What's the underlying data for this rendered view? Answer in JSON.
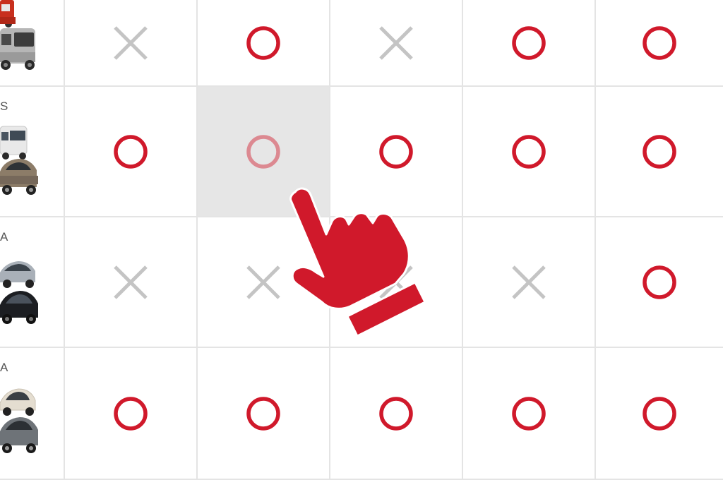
{
  "colors": {
    "circle": "#d0192b",
    "cross": "#c4c4c4",
    "grid_line": "#e4e4e4",
    "highlight": "#e6e6e6",
    "pointer": "#d0192b"
  },
  "rows": [
    {
      "label": "",
      "car_icons": [
        "red-boxy-van-icon",
        "silver-minivan-icon"
      ],
      "marks": [
        "cross",
        "circle",
        "cross",
        "circle",
        "circle"
      ]
    },
    {
      "label": "S",
      "car_icons": [
        "white-minivan-icon",
        "bronze-hatchback-icon"
      ],
      "marks": [
        "circle",
        "circle",
        "circle",
        "circle",
        "circle"
      ]
    },
    {
      "label": "A",
      "car_icons": [
        "silver-sedan-icon",
        "black-sedan-icon"
      ],
      "marks": [
        "cross",
        "cross",
        "cross",
        "cross",
        "circle"
      ]
    },
    {
      "label": "A",
      "car_icons": [
        "white-hatchback-icon",
        "gray-hatchback-icon"
      ],
      "marks": [
        "circle",
        "circle",
        "circle",
        "circle",
        "circle"
      ]
    }
  ],
  "highlighted_cell": {
    "row": 1,
    "col": 1
  },
  "pointer_icon": "hand-pointer-icon"
}
